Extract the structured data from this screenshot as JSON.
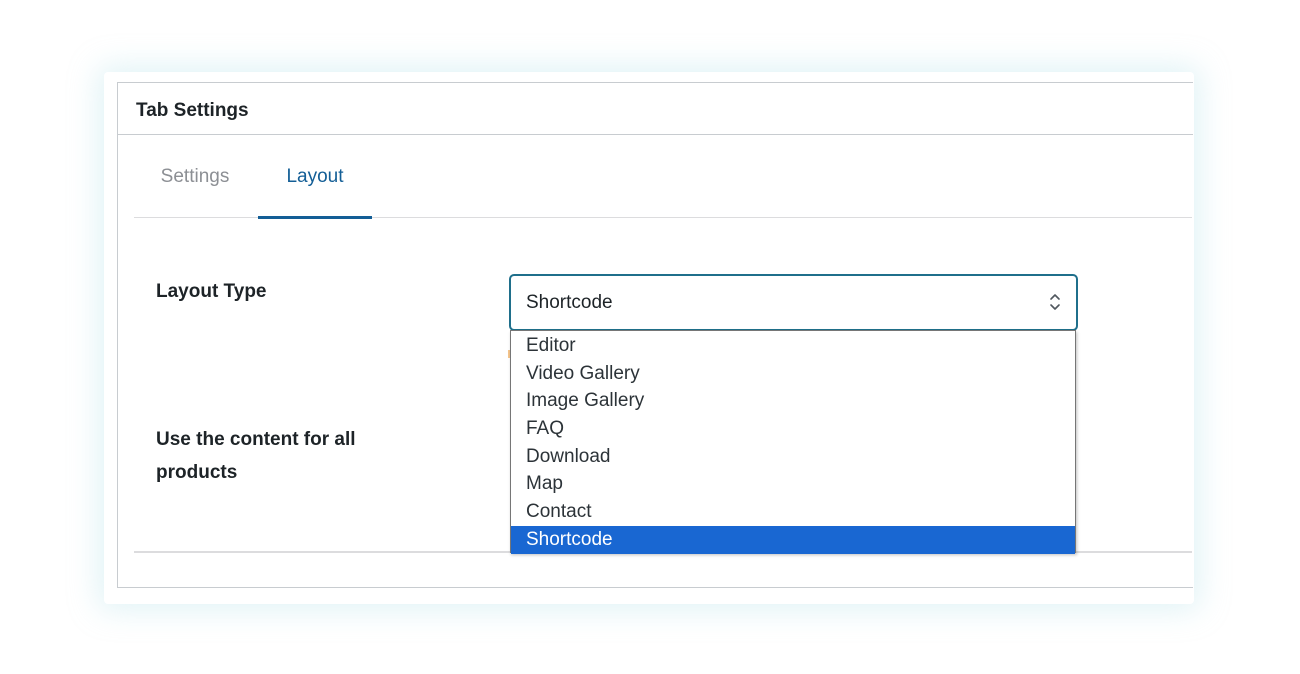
{
  "panel": {
    "title": "Tab Settings"
  },
  "tabs": [
    {
      "label": "Settings",
      "active": false
    },
    {
      "label": "Layout",
      "active": true
    }
  ],
  "fields": {
    "layout_type": {
      "label": "Layout Type",
      "selected_value": "Shortcode",
      "options": [
        "Editor",
        "Video Gallery",
        "Image Gallery",
        "FAQ",
        "Download",
        "Map",
        "Contact",
        "Shortcode"
      ]
    },
    "use_content": {
      "label_line1": "Use the content for all",
      "label_line2": "products"
    }
  },
  "colors": {
    "accent": "#135e96",
    "select_border": "#1f6f8b",
    "selected_option": "#1967d2",
    "inactive_tab": "#8c8f94"
  },
  "icons": {
    "select_chevron": "chevron-up-down-icon"
  }
}
